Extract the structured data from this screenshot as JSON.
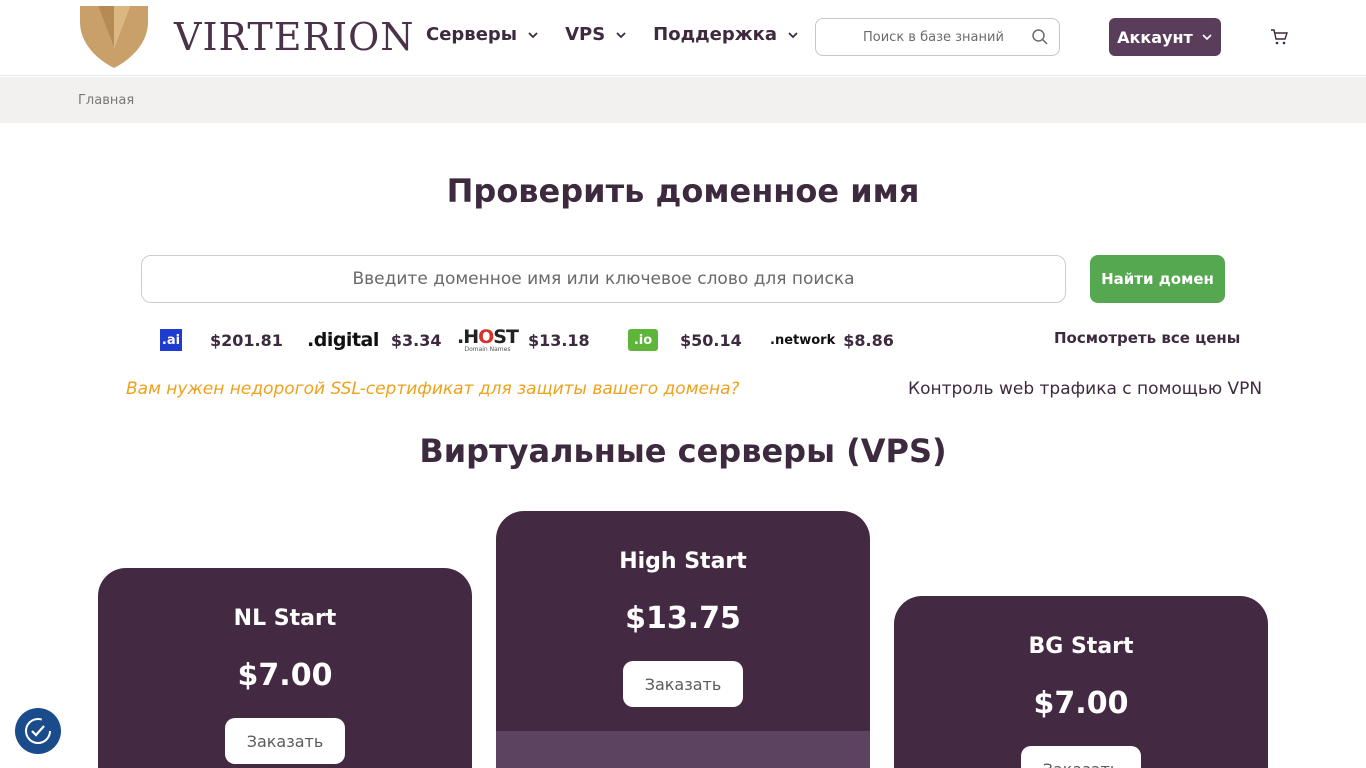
{
  "header": {
    "brand": "VIRTERION",
    "nav": [
      {
        "label": "Серверы"
      },
      {
        "label": "VPS"
      },
      {
        "label": "Поддержка"
      }
    ],
    "search_placeholder": "Поиск в базе знаний",
    "account_label": "Аккаунт"
  },
  "breadcrumb": "Главная",
  "domain": {
    "title": "Проверить доменное имя",
    "input_placeholder": "Введите доменное имя или ключевое слово для поиска",
    "button_label": "Найти домен",
    "tlds": [
      {
        "name": ".ai",
        "price": "$201.81"
      },
      {
        "name": ".digital",
        "price": "$3.34"
      },
      {
        "name": ".host",
        "price": "$13.18"
      },
      {
        "name": ".io",
        "price": "$50.14"
      },
      {
        "name": ".network",
        "price": "$8.86"
      }
    ],
    "all_prices_label": "Посмотреть все цены",
    "ssl_link": "Вам нужен недорогой SSL-сертификат для защиты вашего домена?",
    "vpn_link": "Контроль web трафика с помощью VPN"
  },
  "vps": {
    "title": "Виртуальные серверы (VPS)",
    "plans": [
      {
        "name": "NL Start",
        "price": "$7.00",
        "order_label": "Заказать"
      },
      {
        "name": "High Start",
        "price": "$13.75",
        "order_label": "Заказать"
      },
      {
        "name": "BG Start",
        "price": "$7.00",
        "order_label": "Заказать"
      }
    ]
  },
  "colors": {
    "brand_purple": "#432a42",
    "accent_green": "#55a84f",
    "accent_orange": "#f0a11b",
    "logo_gold": "#c9a06a"
  }
}
